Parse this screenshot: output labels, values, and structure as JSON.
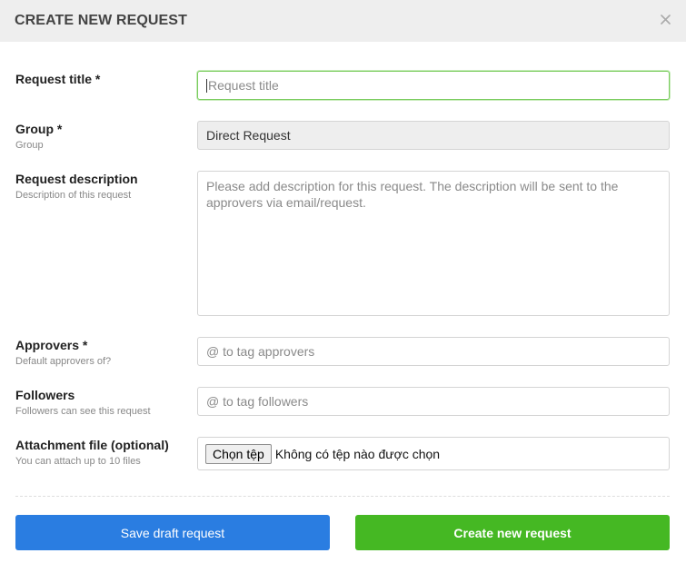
{
  "modal": {
    "title": "CREATE NEW REQUEST",
    "close_icon": "close-icon"
  },
  "fields": {
    "request_title": {
      "label": "Request title *",
      "placeholder": "Request title"
    },
    "group": {
      "label": "Group *",
      "sublabel": "Group",
      "value": "Direct Request"
    },
    "description": {
      "label": "Request description",
      "sublabel": "Description of this request",
      "placeholder": "Please add description for this request. The description will be sent to the approvers via email/request."
    },
    "approvers": {
      "label": "Approvers *",
      "sublabel": "Default approvers of?",
      "placeholder": "@ to tag approvers"
    },
    "followers": {
      "label": "Followers",
      "sublabel": "Followers can see this request",
      "placeholder": "@ to tag followers"
    },
    "attachment": {
      "label": "Attachment file (optional)",
      "sublabel": "You can attach up to 10 files",
      "button_label": "Chọn tệp",
      "status": "Không có tệp nào được chọn"
    }
  },
  "actions": {
    "save_draft_label": "Save draft request",
    "create_label": "Create new request"
  },
  "colors": {
    "save_button": "#2a7de1",
    "create_button": "#45b823",
    "focus_border": "#79cc5d"
  }
}
